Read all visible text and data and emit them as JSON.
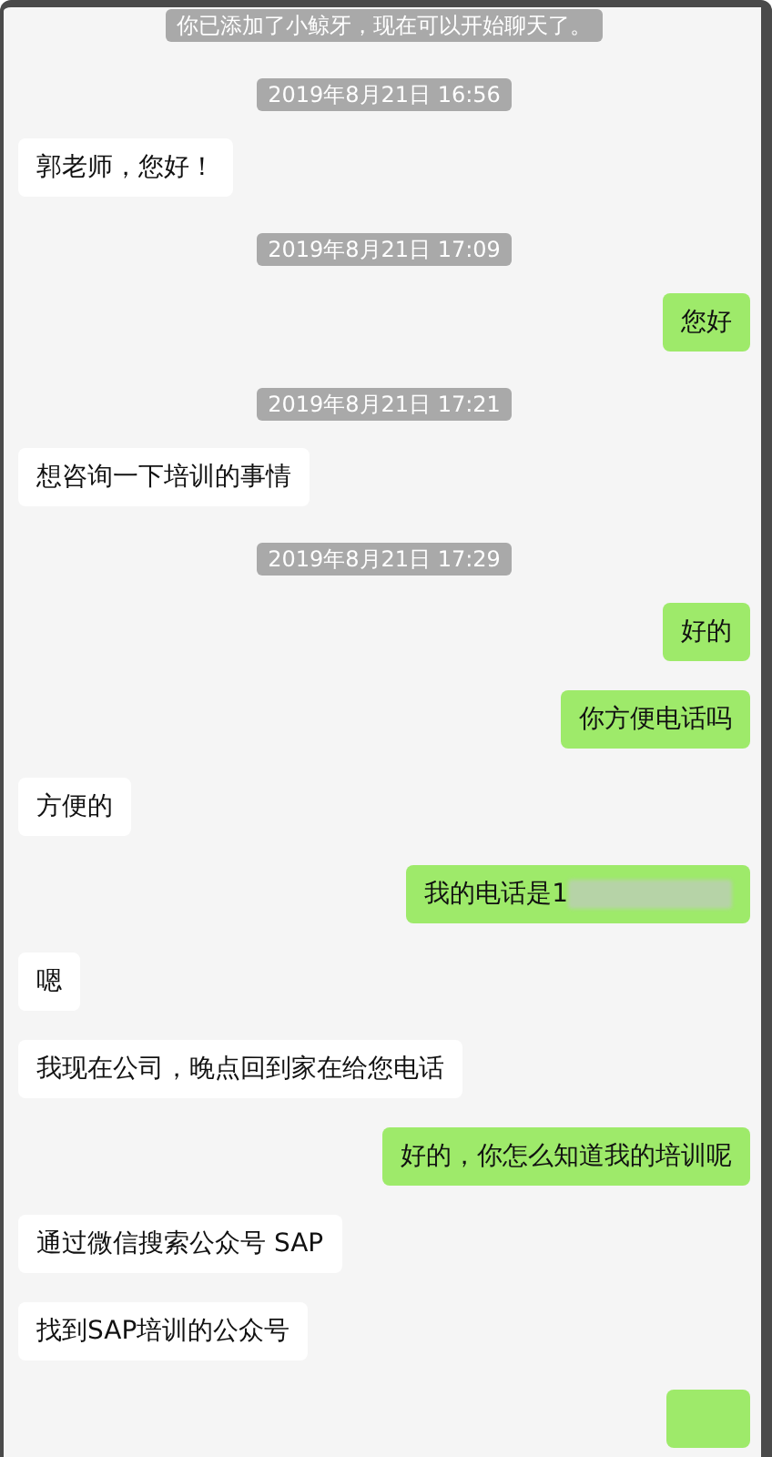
{
  "items": [
    {
      "kind": "system",
      "text": "你已添加了小鲸牙，现在可以开始聊天了。"
    },
    {
      "kind": "time",
      "text": "2019年8月21日 16:56"
    },
    {
      "kind": "incoming",
      "text": "郭老师，您好！"
    },
    {
      "kind": "time",
      "text": "2019年8月21日 17:09"
    },
    {
      "kind": "outgoing",
      "text": "您好"
    },
    {
      "kind": "time",
      "text": "2019年8月21日 17:21"
    },
    {
      "kind": "incoming",
      "text": "想咨询一下培训的事情"
    },
    {
      "kind": "time",
      "text": "2019年8月21日 17:29"
    },
    {
      "kind": "outgoing",
      "text": "好的"
    },
    {
      "kind": "outgoing",
      "text": "你方便电话吗"
    },
    {
      "kind": "incoming",
      "text": "方便的"
    },
    {
      "kind": "outgoing",
      "text": "我的电话是1",
      "redacted": true
    },
    {
      "kind": "incoming",
      "text": "嗯"
    },
    {
      "kind": "incoming",
      "text": "我现在公司，晚点回到家在给您电话"
    },
    {
      "kind": "outgoing",
      "text": "好的，你怎么知道我的培训呢"
    },
    {
      "kind": "incoming",
      "text": "通过微信搜索公众号 SAP"
    },
    {
      "kind": "incoming",
      "text": "找到SAP培训的公众号"
    },
    {
      "kind": "outgoing"
    }
  ]
}
